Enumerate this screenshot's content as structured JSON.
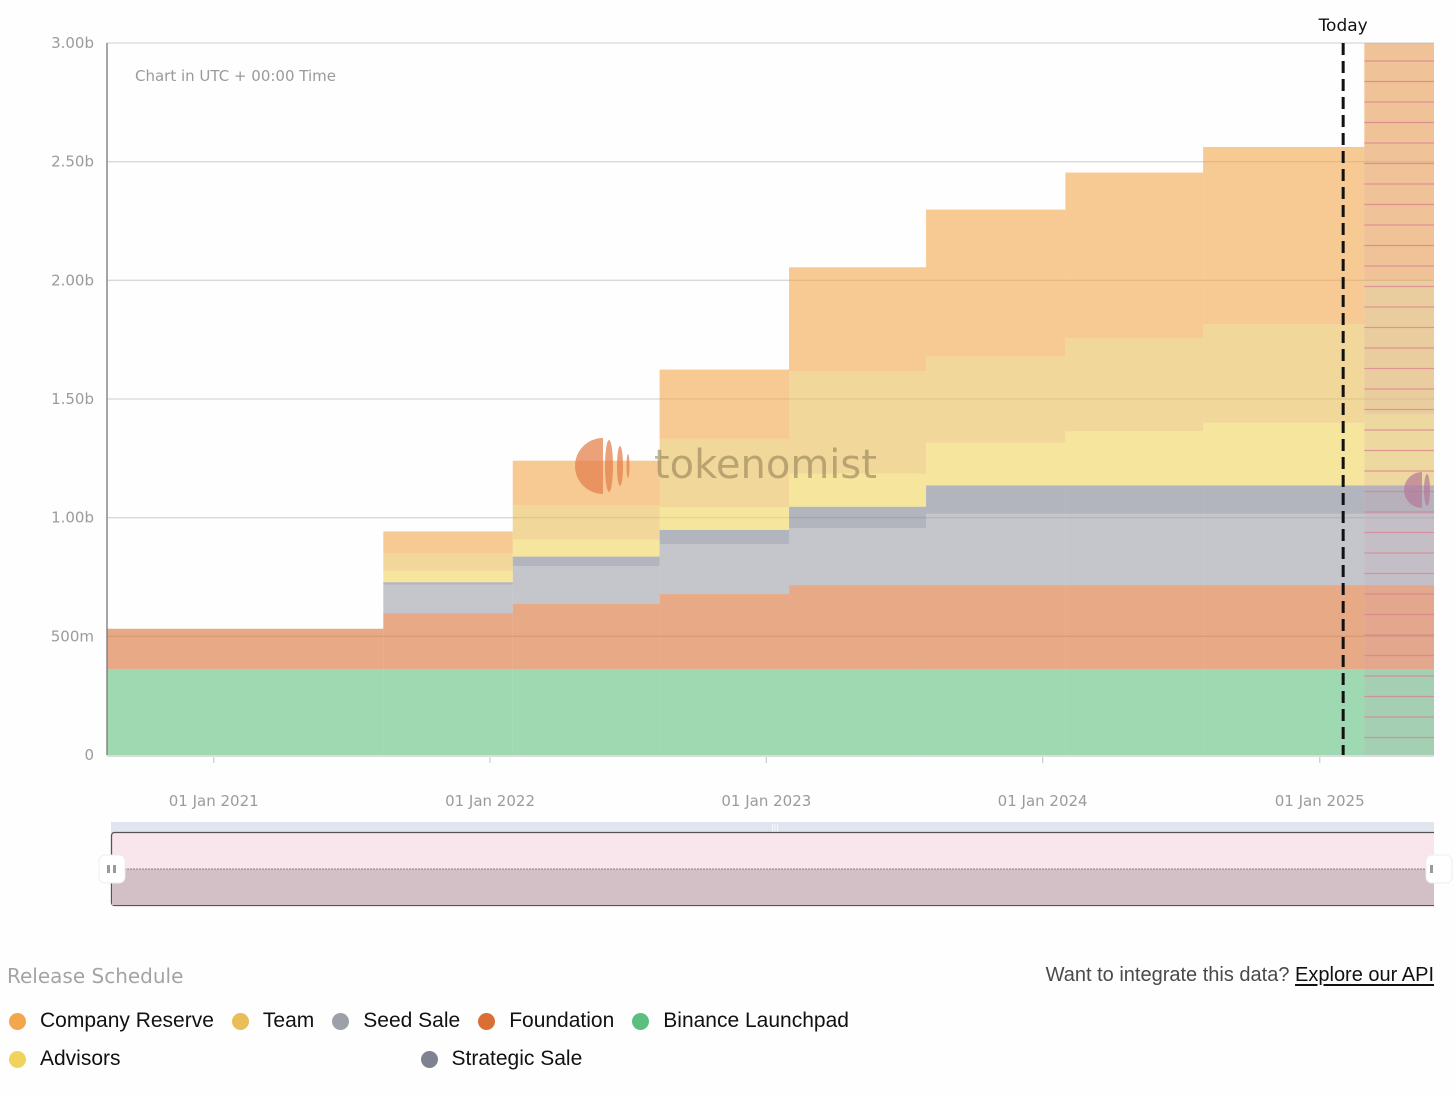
{
  "chart_data": {
    "type": "area",
    "subtype": "stacked-step",
    "note": "Chart in UTC + 00:00 Time",
    "today_label": "Today",
    "today_date": "2025-02",
    "ylim": [
      0,
      3000000000
    ],
    "y_ticks": [
      {
        "value": 0,
        "label": "0"
      },
      {
        "value": 500000000,
        "label": "500m"
      },
      {
        "value": 1000000000,
        "label": "1.00b"
      },
      {
        "value": 1500000000,
        "label": "1.50b"
      },
      {
        "value": 2000000000,
        "label": "2.00b"
      },
      {
        "value": 2500000000,
        "label": "2.50b"
      },
      {
        "value": 3000000000,
        "label": "3.00b"
      }
    ],
    "x_range": [
      "2020-08-13",
      "2025-06-01"
    ],
    "x_ticks": [
      {
        "date": "2021-01-01",
        "label": "01 Jan 2021"
      },
      {
        "date": "2022-01-01",
        "label": "01 Jan 2022"
      },
      {
        "date": "2023-01-01",
        "label": "01 Jan 2023"
      },
      {
        "date": "2024-01-01",
        "label": "01 Jan 2024"
      },
      {
        "date": "2025-01-01",
        "label": "01 Jan 2025"
      }
    ],
    "grid": true,
    "step_dates": [
      "2020-08-13",
      "2021-08-13",
      "2022-01-31",
      "2022-08-13",
      "2023-01-31",
      "2023-07-31",
      "2024-01-31",
      "2024-07-31",
      "2025-03-01",
      "2025-06-01"
    ],
    "series": [
      {
        "name": "Binance Launchpad",
        "color": "#5dbf7f",
        "values": [
          362,
          362,
          362,
          362,
          362,
          362,
          362,
          362,
          362
        ]
      },
      {
        "name": "Foundation",
        "color": "#d96f35",
        "values": [
          170,
          236,
          274,
          316,
          354,
          354,
          354,
          354,
          354
        ]
      },
      {
        "name": "Seed Sale",
        "color": "#9ca0a8",
        "values": [
          0,
          120,
          160,
          210,
          240,
          300,
          300,
          300,
          300
        ]
      },
      {
        "name": "Strategic Sale",
        "color": "#7f8391",
        "values": [
          0,
          10,
          40,
          60,
          90,
          120,
          120,
          120,
          120
        ]
      },
      {
        "name": "Advisors",
        "color": "#f0d35c",
        "values": [
          0,
          48,
          72,
          96,
          140,
          180,
          228,
          264,
          300
        ]
      },
      {
        "name": "Team",
        "color": "#e9bd58",
        "values": [
          0,
          72,
          144,
          288,
          432,
          362,
          392,
          415,
          560
        ]
      },
      {
        "name": "Company Reserve",
        "color": "#f3a64b",
        "values": [
          0,
          94,
          188,
          292,
          437,
          620,
          698,
          747,
          1030
        ]
      }
    ],
    "values_unit": "millions of tokens",
    "legend_position": "bottom-left"
  },
  "footer": {
    "release_schedule_label": "Release Schedule",
    "api_prompt": "Want to integrate this data?",
    "api_link": "Explore our API"
  },
  "legend": [
    {
      "label": "Company Reserve",
      "color": "#f3a64b"
    },
    {
      "label": "Team",
      "color": "#e9bd58"
    },
    {
      "label": "Seed Sale",
      "color": "#9ca0a8"
    },
    {
      "label": "Foundation",
      "color": "#d96f35"
    },
    {
      "label": "Binance Launchpad",
      "color": "#5dbf7f"
    },
    {
      "label": "Advisors",
      "color": "#f0d35c"
    },
    {
      "label": "Strategic Sale",
      "color": "#7f8391"
    }
  ],
  "watermark": {
    "text": "tokenomist"
  }
}
